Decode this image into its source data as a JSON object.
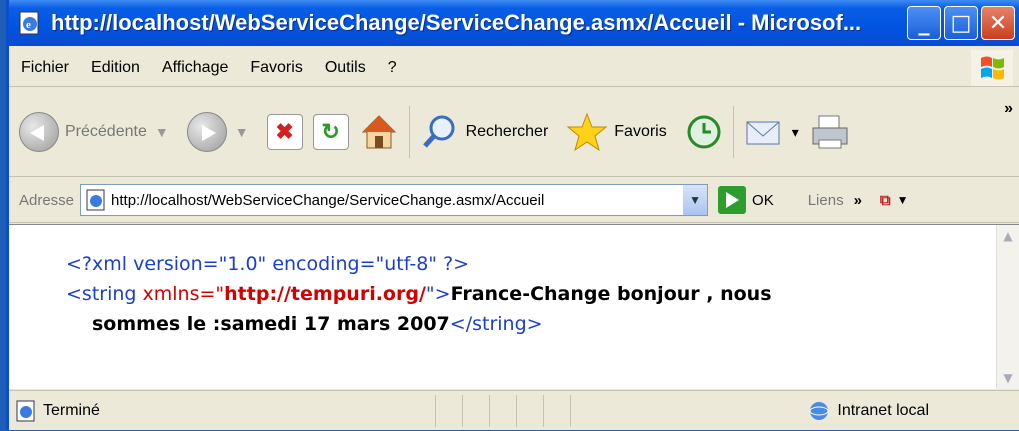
{
  "window": {
    "title": "http://localhost/WebServiceChange/ServiceChange.asmx/Accueil - Microsof...",
    "minimize": "_",
    "maximize": "□",
    "close": "✕"
  },
  "menu": {
    "items": [
      "Fichier",
      "Edition",
      "Affichage",
      "Favoris",
      "Outils",
      "?"
    ]
  },
  "toolbar": {
    "back_label": "Précédente",
    "search_label": "Rechercher",
    "favorites_label": "Favoris"
  },
  "address": {
    "label": "Adresse",
    "url": "http://localhost/WebServiceChange/ServiceChange.asmx/Accueil",
    "go_label": "OK",
    "links_label": "Liens"
  },
  "content": {
    "xml_decl": "<?xml version=\"1.0\" encoding=\"utf-8\" ?>",
    "tag_open_start": "<string ",
    "attr_name": "xmlns=\"",
    "attr_value": "http://tempuri.org/",
    "tag_open_end": "\">",
    "text_line1": "France-Change bonjour , nous",
    "text_line2": "sommes le :samedi 17 mars 2007",
    "tag_close": "</string>"
  },
  "status": {
    "text": "Terminé",
    "zone": "Intranet local"
  },
  "colors": {
    "titlebar": "#0053e0",
    "xml_markup": "#1a3fd0",
    "xml_attr_value": "#d40000"
  }
}
